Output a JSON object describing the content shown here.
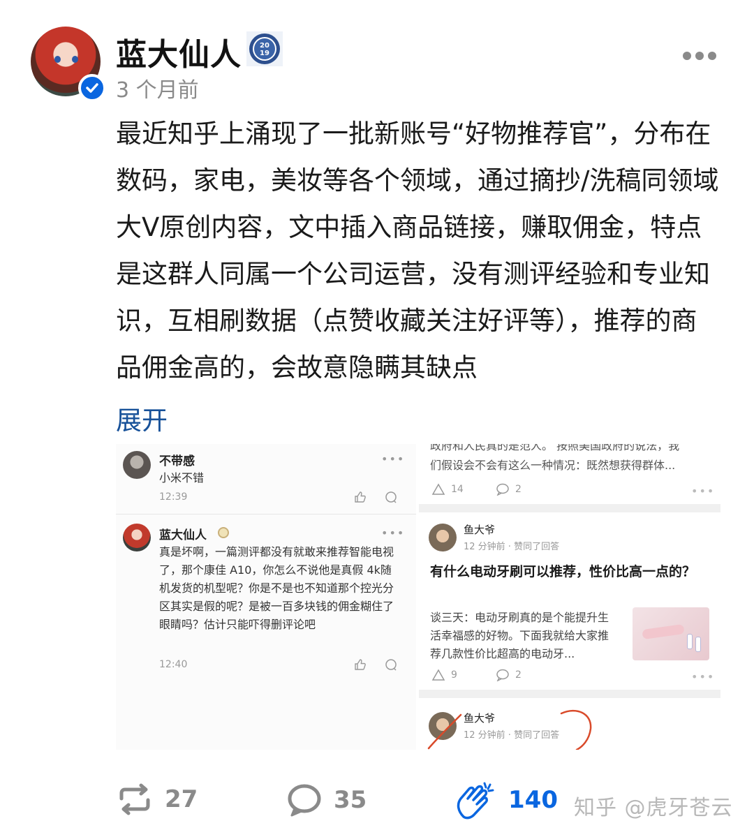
{
  "author": {
    "name": "蓝大仙人",
    "badge_text": "2019",
    "time": "3 个月前"
  },
  "post": {
    "content": "最近知乎上涌现了一批新账号“好物推荐官”，分布在数码，家电，美妆等各个领域，通过摘抄/洗稿同领域大V原创内容，文中插入商品链接，赚取佣金，特点是这群人同属一个公司运营，没有测评经验和专业知识，互相刷数据（点赞收藏关注好评等），推荐的商品佣金高的，会故意隐瞒其缺点",
    "expand_label": "展开"
  },
  "screenshot_left": {
    "comment1": {
      "name": "不带感",
      "text": "小米不错",
      "time": "12:39"
    },
    "comment2": {
      "name": "蓝大仙人",
      "text": "真是坏啊，一篇测评都没有就敢来推荐智能电视了，那个康佳 A10，你怎么不说他是真假 4k随机发货的机型呢？你是不是也不知道那个控光分区其实是假的呢？是被一百多块钱的佣金糊住了眼睛吗？估计只能吓得删评论吧",
      "time": "12:40"
    }
  },
  "screenshot_right": {
    "top_card": {
      "text_cut": "政府和人民真的是范人。 按照美国政府的说法，我",
      "text": "们假设会不会有这么一种情况：既然想获得群体...",
      "likes": "14",
      "comments": "2"
    },
    "card2": {
      "user": "鱼大爷",
      "meta": "12 分钟前 · 赞同了回答",
      "title": "有什么电动牙刷可以推荐，性价比高一点的？",
      "excerpt": "谈三天：电动牙刷真的是个能提升生活幸福感的好物。下面我就给大家推荐几款性价比超高的电动牙...",
      "likes": "9",
      "comments": "2"
    },
    "card3": {
      "user": "鱼大爷",
      "meta": "12 分钟前 · 赞同了回答"
    }
  },
  "footer": {
    "repost_count": "27",
    "comment_count": "35",
    "like_count": "140",
    "watermark": "知乎 @虎牙苍云"
  },
  "colors": {
    "accent": "#0a66e0",
    "link": "#175199",
    "annotation": "#d94a2a"
  },
  "icons": [
    "verified-icon",
    "year-badge-icon",
    "more-icon",
    "thumb-up-icon",
    "reply-icon",
    "triangle-up-icon",
    "comment-icon",
    "repost-icon",
    "clap-icon"
  ]
}
